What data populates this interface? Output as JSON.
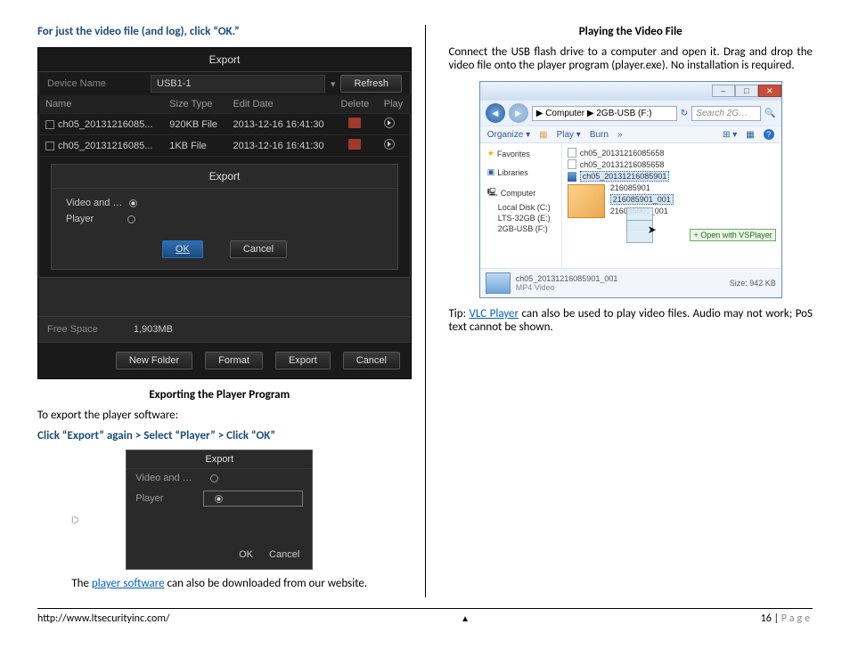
{
  "left": {
    "heading1": "For just the video file (and log), click “OK.”",
    "caption1": "Exporting the Player Program",
    "body1": "To export the player software:",
    "instr1": "Click “Export” again > Select “Player” > Click “OK”",
    "body2_pre": "The ",
    "body2_link": "player software",
    "body2_post": " can also be downloaded from our website."
  },
  "export_dialog": {
    "title": "Export",
    "device_label": "Device Name",
    "device_value": "USB1-1",
    "refresh": "Refresh",
    "th_name": "Name",
    "th_size": "Size Type",
    "th_edit": "Edit Date",
    "th_del": "Delete",
    "th_play": "Play",
    "rows": [
      {
        "name": "ch05_20131216085...",
        "size": "920KB File",
        "date": "2013-12-16 16:41:30"
      },
      {
        "name": "ch05_20131216085...",
        "size": "1KB File",
        "date": "2013-12-16 16:41:30"
      }
    ],
    "sub_title": "Export",
    "radio1": "Video and …",
    "radio2": "Player",
    "ok": "OK",
    "cancel": "Cancel",
    "free_label": "Free Space",
    "free_value": "1,903MB",
    "btn_newfolder": "New Folder",
    "btn_format": "Format",
    "btn_export": "Export",
    "btn_cancel": "Cancel"
  },
  "small_export": {
    "title": "Export",
    "radio1": "Video and …",
    "radio2": "Player",
    "ok": "OK",
    "cancel": "Cancel"
  },
  "right": {
    "heading": "Playing the Video File",
    "body1": "Connect the USB flash drive to a computer and open it.  Drag and drop the video file onto the player program (player.exe).  No installation is required.",
    "tip_pre": "Tip: ",
    "tip_link": "VLC Player",
    "tip_post": " can also be used to play video files.  Audio may not work; PoS text cannot be shown."
  },
  "explorer": {
    "crumb": "▶ Computer ▶ 2GB-USB (F:)",
    "search_placeholder": "Search 2G…",
    "organize": "Organize ▾",
    "play": "Play ▾",
    "burn": "Burn",
    "more": "»",
    "side": {
      "fav": "Favorites",
      "lib": "Libraries",
      "comp": "Computer",
      "c": "Local Disk (C:)",
      "e": "LTS-32GB (E:)",
      "f": "2GB-USB (F:)"
    },
    "files": {
      "f1": "ch05_20131216085658",
      "f2": "ch05_20131216085658",
      "f3": "ch05_20131216085901",
      "f4": "216085901",
      "f5": "216085901_001",
      "f6": "216085901_001",
      "openwith": "+ Open with VSPlayer"
    },
    "status_name": "ch05_20131216085901_001",
    "status_type": "MP4 Video",
    "status_size": "Size: 942 KB",
    "ctrl_min": "–",
    "ctrl_max": "□",
    "ctrl_close": "✕"
  },
  "footer": {
    "url": "http://www.ltsecurityinc.com/",
    "marker": "▲",
    "num": "16",
    "sep": " | ",
    "label": "Page"
  }
}
